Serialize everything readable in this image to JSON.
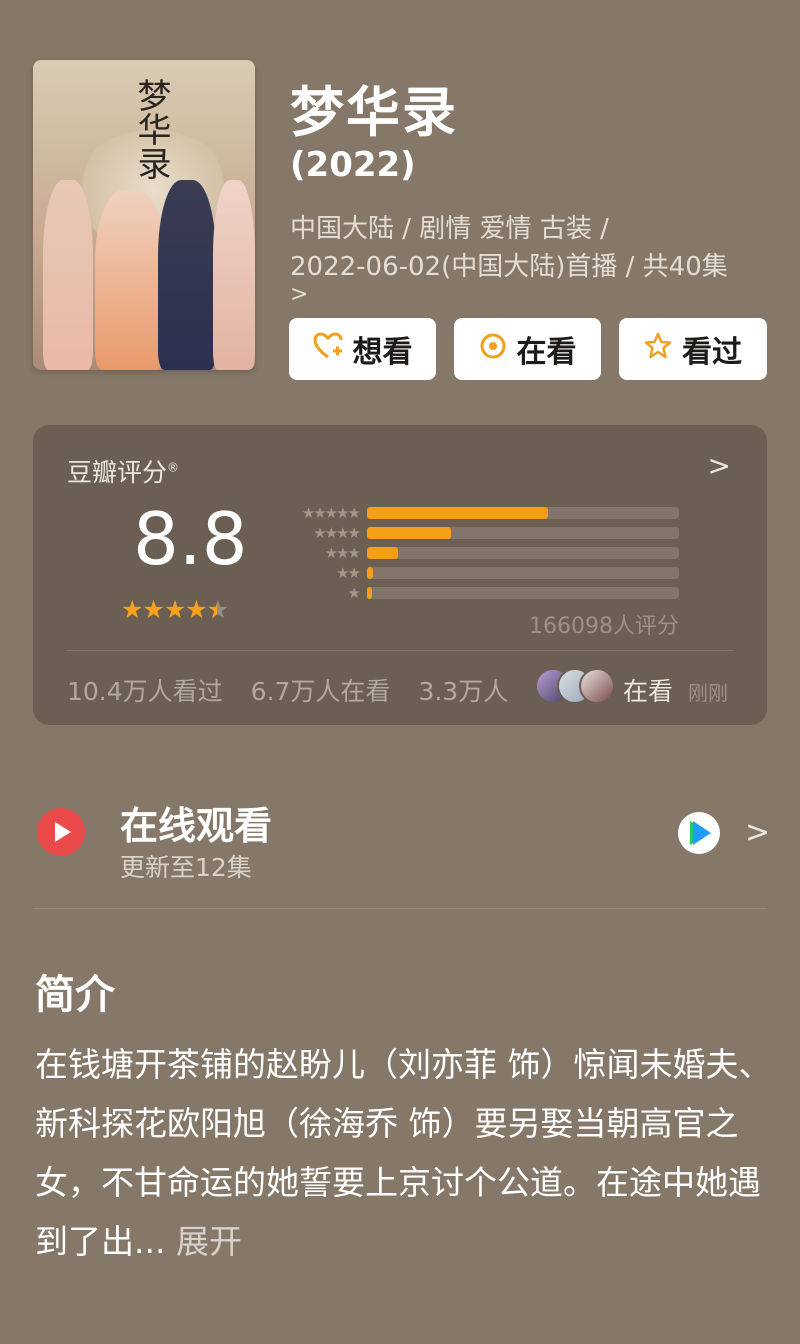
{
  "movie": {
    "title": "梦华录",
    "year": "(2022)",
    "meta_line1": "中国大陆 / 剧情 爱情 古装 /",
    "meta_line2": "2022-06-02(中国大陆)首播 / 共40集",
    "meta_chevron": ">",
    "poster_calligraphy": "梦华录"
  },
  "actions": {
    "want": {
      "label": "想看",
      "icon": "heart-plus-icon"
    },
    "watching": {
      "label": "在看",
      "icon": "target-circle-icon"
    },
    "watched": {
      "label": "看过",
      "icon": "star-outline-icon"
    },
    "accent_color": "#f0a021"
  },
  "rating": {
    "label": "豆瓣评分",
    "registered_mark": "®",
    "more": ">",
    "score": "8.8",
    "stars_out_of_5": 4.5,
    "distribution": [
      {
        "stars": "★★★★★",
        "fraction": 0.58
      },
      {
        "stars": "★★★★",
        "fraction": 0.27
      },
      {
        "stars": "★★★",
        "fraction": 0.1
      },
      {
        "stars": "★★",
        "fraction": 0.02
      },
      {
        "stars": "★",
        "fraction": 0.015
      }
    ],
    "count": "166098人评分",
    "watched": "10.4万人看过",
    "watching": "6.7万人在看",
    "want": "3.3万人",
    "status_label": "在看",
    "status_time": "刚刚",
    "bar_color": "#f59e18"
  },
  "online": {
    "title": "在线观看",
    "subtitle": "更新至12集",
    "provider_icon": "tencent-video-icon",
    "chevron": ">"
  },
  "intro": {
    "title": "简介",
    "text": "在钱塘开茶铺的赵盼儿（刘亦菲 饰）惊闻未婚夫、新科探花欧阳旭（徐海乔 饰）要另娶当朝高官之女，不甘命运的她誓要上京讨个公道。在途中她遇到了出...",
    "expand": " 展开"
  }
}
